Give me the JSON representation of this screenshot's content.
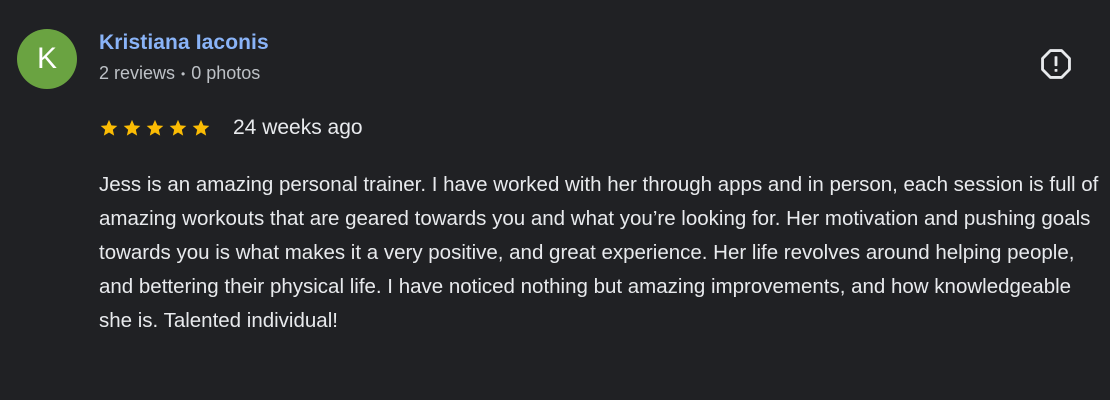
{
  "review": {
    "avatar_initial": "K",
    "author_name": "Kristiana Iaconis",
    "reviews_count": "2 reviews",
    "meta_separator": "•",
    "photos_count": "0 photos",
    "rating": 5,
    "rating_max": 5,
    "date": "24 weeks ago",
    "text": "Jess is an amazing personal trainer. I have worked with her through apps and in person, each session is full of amazing workouts that are geared towards you and what you’re looking for. Her motivation and pushing goals towards you is what makes it a very positive, and great experience. Her life revolves around helping people, and bettering their physical life. I have noticed nothing but amazing improvements, and how knowledgeable she is. Talented individual!"
  },
  "icons": {
    "report": "report-flag-icon",
    "star": "star-icon"
  },
  "colors": {
    "background": "#202124",
    "avatar": "#6aa341",
    "author_link": "#8ab4f8",
    "star": "#fbbc04",
    "text": "#e8eaed",
    "meta": "#bdc1c6"
  }
}
